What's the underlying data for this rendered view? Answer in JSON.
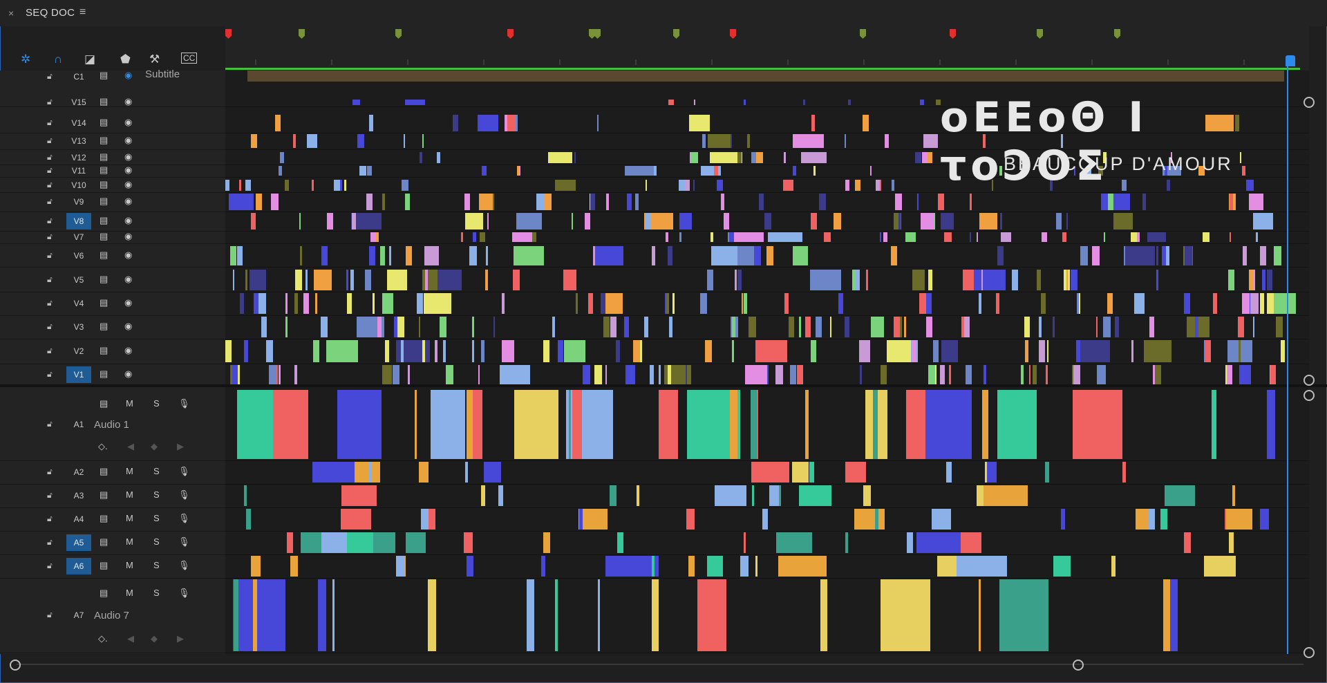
{
  "tab": {
    "close_icon": "×",
    "title": "SEQ DOC",
    "menu_icon": "≡"
  },
  "tools": [
    "snap-icon",
    "magnet-icon",
    "linked-selection-icon",
    "marker-icon",
    "wrench-icon",
    "captions-icon"
  ],
  "captions_track": {
    "name": "C1",
    "label": "Subtitle"
  },
  "video_tracks": [
    "V15",
    "V14",
    "V13",
    "V12",
    "V11",
    "V10",
    "V9",
    "V8",
    "V7",
    "V6",
    "V5",
    "V4",
    "V3",
    "V2",
    "V1"
  ],
  "audio_tracks": [
    {
      "name": "A1",
      "label": "Audio 1"
    },
    {
      "name": "A2",
      "label": ""
    },
    {
      "name": "A3",
      "label": ""
    },
    {
      "name": "A4",
      "label": ""
    },
    {
      "name": "A5",
      "label": ""
    },
    {
      "name": "A6",
      "label": ""
    },
    {
      "name": "A7",
      "label": "Audio 7"
    }
  ],
  "audio_buttons": {
    "mute": "M",
    "solo": "S"
  },
  "overlay": {
    "title": "οΕΕοΘ Ι τοϽΟΣ",
    "subtitle": "BEAUCOUP D'AMOUR"
  },
  "colors": {
    "accent": "#2d8ceb",
    "track_selected": "#1f5b94",
    "ruler_line": "#46c03c"
  }
}
